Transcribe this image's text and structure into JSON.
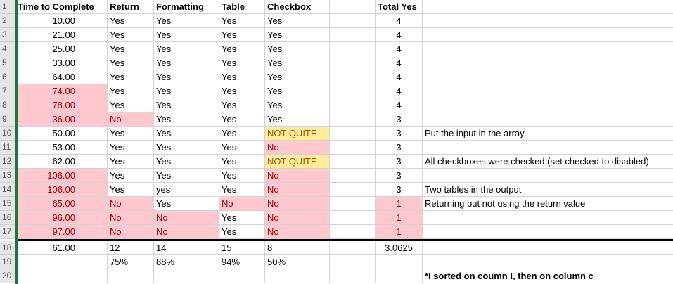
{
  "headers": {
    "time": "Time to Complete",
    "ret": "Return",
    "fmt": "Formatting",
    "table": "Table",
    "chk": "Checkbox",
    "total": "Total Yes"
  },
  "rows": [
    {
      "n": "2",
      "time": "10.00",
      "ret": "Yes",
      "fmt": "Yes",
      "table": "Yes",
      "chk": "Yes",
      "total": "4",
      "note": ""
    },
    {
      "n": "3",
      "time": "21.00",
      "ret": "Yes",
      "fmt": "Yes",
      "table": "Yes",
      "chk": "Yes",
      "total": "4",
      "note": ""
    },
    {
      "n": "4",
      "time": "25.00",
      "ret": "Yes",
      "fmt": "Yes",
      "table": "Yes",
      "chk": "Yes",
      "total": "4",
      "note": ""
    },
    {
      "n": "5",
      "time": "33.00",
      "ret": "Yes",
      "fmt": "Yes",
      "table": "Yes",
      "chk": "Yes",
      "total": "4",
      "note": ""
    },
    {
      "n": "6",
      "time": "64.00",
      "ret": "Yes",
      "fmt": "Yes",
      "table": "Yes",
      "chk": "Yes",
      "total": "4",
      "note": ""
    },
    {
      "n": "7",
      "time": "74.00",
      "ret": "Yes",
      "fmt": "Yes",
      "table": "Yes",
      "chk": "Yes",
      "total": "4",
      "note": ""
    },
    {
      "n": "8",
      "time": "78.00",
      "ret": "Yes",
      "fmt": "Yes",
      "table": "Yes",
      "chk": "Yes",
      "total": "4",
      "note": ""
    },
    {
      "n": "9",
      "time": "36.00",
      "ret": "No",
      "fmt": "Yes",
      "table": "Yes",
      "chk": "Yes",
      "total": "3",
      "note": ""
    },
    {
      "n": "10",
      "time": "50.00",
      "ret": "Yes",
      "fmt": "Yes",
      "table": "Yes",
      "chk": "NOT QUITE",
      "total": "3",
      "note": "Put the input in the array"
    },
    {
      "n": "11",
      "time": "53.00",
      "ret": "Yes",
      "fmt": "Yes",
      "table": "Yes",
      "chk": "No",
      "total": "3",
      "note": ""
    },
    {
      "n": "12",
      "time": "62.00",
      "ret": "Yes",
      "fmt": "Yes",
      "table": "Yes",
      "chk": "NOT QUITE",
      "total": "3",
      "note": "All checkboxes were checked (set checked to disabled)"
    },
    {
      "n": "13",
      "time": "106.00",
      "ret": "Yes",
      "fmt": "Yes",
      "table": "Yes",
      "chk": "No",
      "total": "3",
      "note": ""
    },
    {
      "n": "14",
      "time": "106.00",
      "ret": "Yes",
      "fmt": "yes",
      "table": "Yes",
      "chk": "No",
      "total": "3",
      "note": "Two tables in the output"
    },
    {
      "n": "15",
      "time": "65.00",
      "ret": "No",
      "fmt": "Yes",
      "table": "No",
      "chk": "No",
      "total": "1",
      "note": "Returning but not using the return value"
    },
    {
      "n": "16",
      "time": "96.00",
      "ret": "No",
      "fmt": "No",
      "table": "Yes",
      "chk": "No",
      "total": "1",
      "note": ""
    },
    {
      "n": "17",
      "time": "97.00",
      "ret": "No",
      "fmt": "No",
      "table": "Yes",
      "chk": "No",
      "total": "1",
      "note": ""
    }
  ],
  "totals": {
    "n": "18",
    "time": "61.00",
    "ret": "12",
    "fmt": "14",
    "table": "15",
    "chk": "8",
    "total": "3.0625"
  },
  "percents": {
    "n": "19",
    "ret": "75%",
    "fmt": "88%",
    "table": "94%",
    "chk": "50%"
  },
  "footnote": {
    "n": "20",
    "text": "*I sorted on coumn I, then on column c"
  },
  "header_row_number": "1",
  "colors": {
    "bad_fill": "#ffc7ce",
    "bad_text": "#9c0006",
    "neutral_fill": "#ffeb9c",
    "neutral_text": "#9c5700",
    "selection": "#217346"
  }
}
